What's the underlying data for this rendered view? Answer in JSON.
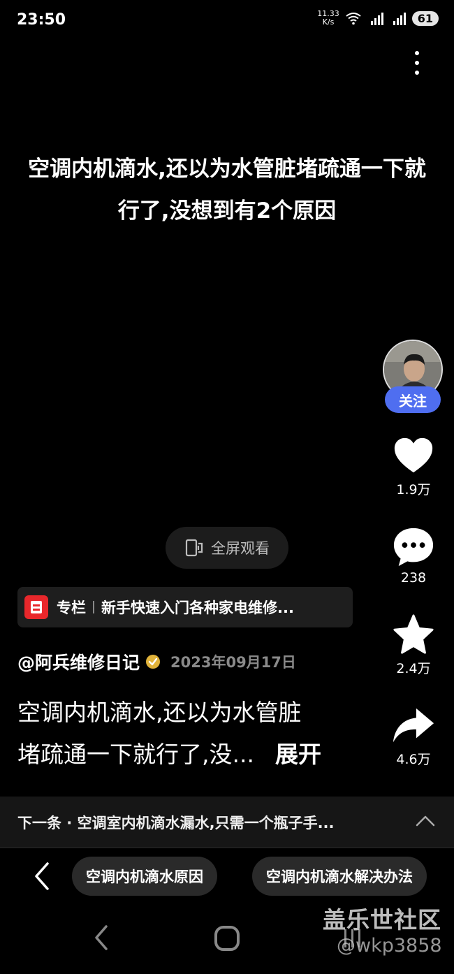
{
  "status_bar": {
    "time": "23:50",
    "net_speed_value": "11.33",
    "net_speed_unit": "K/s",
    "battery": "61",
    "icons": [
      "wifi-icon",
      "signal-4g-icon",
      "signal-5g-icon"
    ]
  },
  "video": {
    "title": "空调内机滴水,还以为水管脏堵疏通一下就行了,没想到有2个原因",
    "fullscreen_label": "全屏观看"
  },
  "rail": {
    "follow_label": "关注",
    "likes": "1.9万",
    "comments": "238",
    "favorites": "2.4万",
    "shares": "4.6万"
  },
  "column": {
    "label": "专栏",
    "text": "新手快速入门各种家电维修..."
  },
  "author": {
    "name": "@阿兵维修日记",
    "date": "2023年09月17日"
  },
  "description": {
    "line1": "空调内机滴水,还以为水管脏",
    "line2": "堵疏通一下就行了,没...",
    "expand_label": "展开"
  },
  "next": {
    "text": "下一条 · 空调室内机滴水漏水,只需一个瓶子手..."
  },
  "search_chips": [
    "空调内机滴水原因",
    "空调内机滴水解决办法"
  ],
  "watermark": {
    "title": "盖乐世社区",
    "user": "@wkp3858"
  },
  "colors": {
    "follow_accent": "#4f6ef0",
    "column_icon": "#e8272b",
    "verified": "#e0b23a"
  }
}
